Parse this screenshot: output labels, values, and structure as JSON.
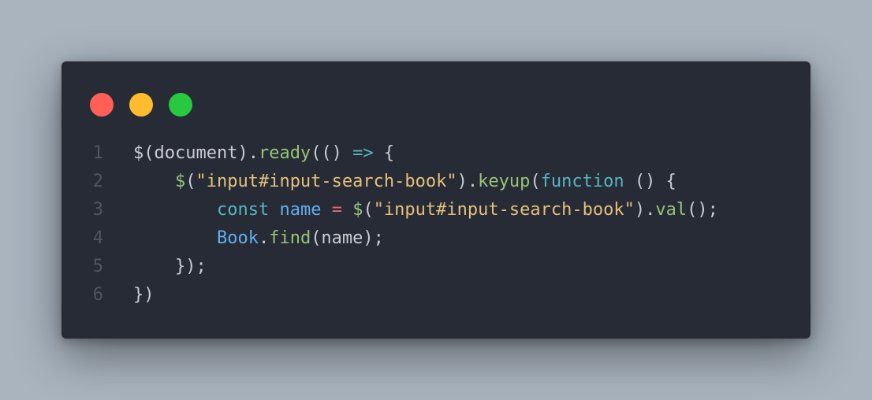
{
  "window_controls": {
    "close_color": "#ff5f57",
    "minimize_color": "#febc2e",
    "zoom_color": "#28c840"
  },
  "colors": {
    "background": "#a9b4bf",
    "editor": "#272b35",
    "line_number": "#4f5562",
    "plain": "#c9ccd3",
    "method": "#98c379",
    "keyword": "#56b6c2",
    "string": "#e5c07b",
    "variable": "#61afef",
    "operator": "#e06c75"
  },
  "code": {
    "lines": [
      {
        "number": "1",
        "tokens": [
          {
            "text": "$(document).",
            "kind": "plain"
          },
          {
            "text": "ready",
            "kind": "method"
          },
          {
            "text": "(() ",
            "kind": "plain"
          },
          {
            "text": "=>",
            "kind": "keyword"
          },
          {
            "text": " {",
            "kind": "plain"
          }
        ]
      },
      {
        "number": "2",
        "tokens": [
          {
            "text": "    ",
            "kind": "plain"
          },
          {
            "text": "$",
            "kind": "method"
          },
          {
            "text": "(",
            "kind": "plain"
          },
          {
            "text": "\"input#input-search-book\"",
            "kind": "string"
          },
          {
            "text": ").",
            "kind": "plain"
          },
          {
            "text": "keyup",
            "kind": "method"
          },
          {
            "text": "(",
            "kind": "plain"
          },
          {
            "text": "function",
            "kind": "keyword"
          },
          {
            "text": " () {",
            "kind": "plain"
          }
        ]
      },
      {
        "number": "3",
        "tokens": [
          {
            "text": "        ",
            "kind": "plain"
          },
          {
            "text": "const",
            "kind": "keyword"
          },
          {
            "text": " ",
            "kind": "plain"
          },
          {
            "text": "name",
            "kind": "variable"
          },
          {
            "text": " ",
            "kind": "plain"
          },
          {
            "text": "=",
            "kind": "operator"
          },
          {
            "text": " ",
            "kind": "plain"
          },
          {
            "text": "$",
            "kind": "method"
          },
          {
            "text": "(",
            "kind": "plain"
          },
          {
            "text": "\"input#input-search-book\"",
            "kind": "string"
          },
          {
            "text": ").",
            "kind": "plain"
          },
          {
            "text": "val",
            "kind": "method"
          },
          {
            "text": "();",
            "kind": "plain"
          }
        ]
      },
      {
        "number": "4",
        "tokens": [
          {
            "text": "        ",
            "kind": "plain"
          },
          {
            "text": "Book",
            "kind": "variable"
          },
          {
            "text": ".",
            "kind": "plain"
          },
          {
            "text": "find",
            "kind": "method"
          },
          {
            "text": "(name);",
            "kind": "plain"
          }
        ]
      },
      {
        "number": "5",
        "tokens": [
          {
            "text": "    });",
            "kind": "plain"
          }
        ]
      },
      {
        "number": "6",
        "tokens": [
          {
            "text": "})",
            "kind": "plain"
          }
        ]
      }
    ]
  }
}
